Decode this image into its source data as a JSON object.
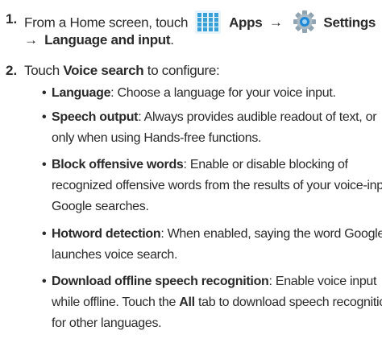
{
  "steps": [
    {
      "number": "1.",
      "text_before": "From a Home screen, touch",
      "apps_label": "Apps",
      "arrow": "→",
      "settings_label": "Settings",
      "arrow2": "→",
      "path_tail": "Language and input",
      "period": "."
    },
    {
      "number": "2.",
      "touch": "Touch",
      "voice_search": "Voice search",
      "configure": "to configure:"
    }
  ],
  "bullets": [
    {
      "term": "Language",
      "lines": [
        ": Choose a language for your voice input."
      ]
    },
    {
      "term": "Speech output",
      "lines": [
        ": Always provides audible readout of text, or",
        "only when using Hands-free functions."
      ]
    },
    {
      "term": "Block offensive words",
      "lines": [
        ": Enable or disable blocking of",
        "recognized offensive words from the results of your voice-input",
        "Google searches."
      ]
    },
    {
      "term": "Hotword detection",
      "lines": [
        ": When enabled, saying the word Google",
        "launches voice search."
      ]
    },
    {
      "term": "Download offline speech recognition",
      "lines": [
        ": Enable voice input",
        "while offline. Touch the ",
        "tab to download speech recognition",
        "for other languages."
      ],
      "all_tab": "All"
    }
  ],
  "bullet_char": "•",
  "icons": {
    "apps": "apps-grid-icon",
    "settings": "settings-gear-icon",
    "apps_color": "#3aa0d8",
    "settings_color": "#5a6f7f"
  }
}
